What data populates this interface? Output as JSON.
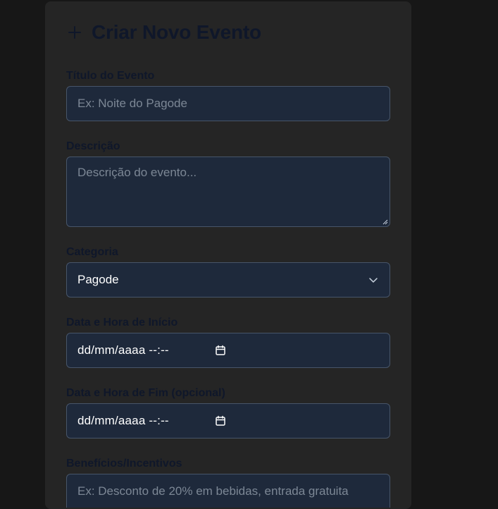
{
  "form": {
    "title": "Criar Novo Evento",
    "plus_icon": "plus-icon",
    "title_label": "Título do Evento",
    "title_placeholder": "Ex: Noite do Pagode",
    "description_label": "Descrição",
    "description_placeholder": "Descrição do evento...",
    "category_label": "Categoria",
    "category_value": "Pagode",
    "start_label": "Data e Hora de Início",
    "start_value": "dd/mm/aaaa --:--",
    "end_label": "Data e Hora de Fim (opcional)",
    "end_value": "dd/mm/aaaa --:--",
    "benefits_label": "Benefícios/Incentivos",
    "benefits_placeholder": "Ex: Desconto de 20% em bebidas, entrada gratuita"
  },
  "colors": {
    "page_bg": "#171717",
    "card_bg": "#252525",
    "field_bg": "#1e293b",
    "field_border": "#475569",
    "label_text": "#0f172a",
    "placeholder_text": "#7c8795"
  }
}
